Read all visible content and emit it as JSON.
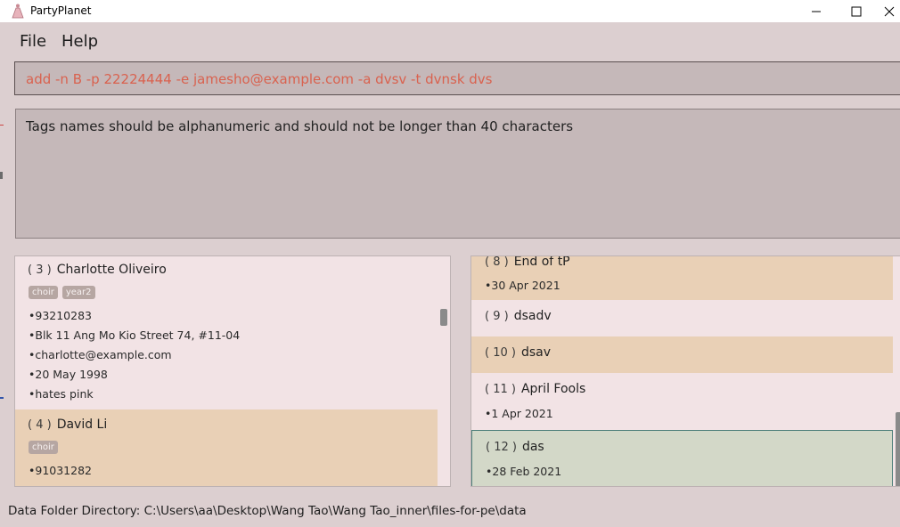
{
  "window": {
    "title": "PartyPlanet"
  },
  "menu": {
    "items": [
      "File",
      "Help"
    ]
  },
  "command_box": {
    "value": "add -n B -p 22224444 -e jamesho@example.com -a dvsv -t dvnsk dvs"
  },
  "result_box": {
    "text": "Tags names should be alphanumeric and should not be longer than 40 characters"
  },
  "persons": [
    {
      "index": "( 3 )",
      "name": "Charlotte Oliveiro",
      "tags": [
        "choir",
        "year2"
      ],
      "phone": "•93210283",
      "address": "•Blk 11 Ang Mo Kio Street 74, #11-04",
      "email": "•charlotte@example.com",
      "birthday": "•20 May 1998",
      "remark": "•hates pink"
    },
    {
      "index": "( 4 )",
      "name": "David Li",
      "tags": [
        "choir"
      ],
      "phone": "•91031282"
    }
  ],
  "events": [
    {
      "index": "( 8 )",
      "name": "End of tP",
      "date": "•30 Apr 2021"
    },
    {
      "index": "( 9 )",
      "name": "dsadv",
      "date": ""
    },
    {
      "index": "( 10 )",
      "name": "dsav",
      "date": ""
    },
    {
      "index": "( 11 )",
      "name": "April Fools",
      "date": "•1 Apr 2021"
    },
    {
      "index": "( 12 )",
      "name": "das",
      "date": "•28 Feb 2021"
    }
  ],
  "status_bar": {
    "text": "Data Folder Directory: C:\\Users\\aa\\Desktop\\Wang Tao\\Wang Tao_inner\\files-for-pe\\data"
  },
  "colors": {
    "background": "#dccfd0",
    "command_text": "#d9624f",
    "card_pink": "#f2e3e5",
    "card_tan": "#e9d0b6",
    "card_selected": "#d3d8c8",
    "tag_bg": "#b6a6a2"
  }
}
